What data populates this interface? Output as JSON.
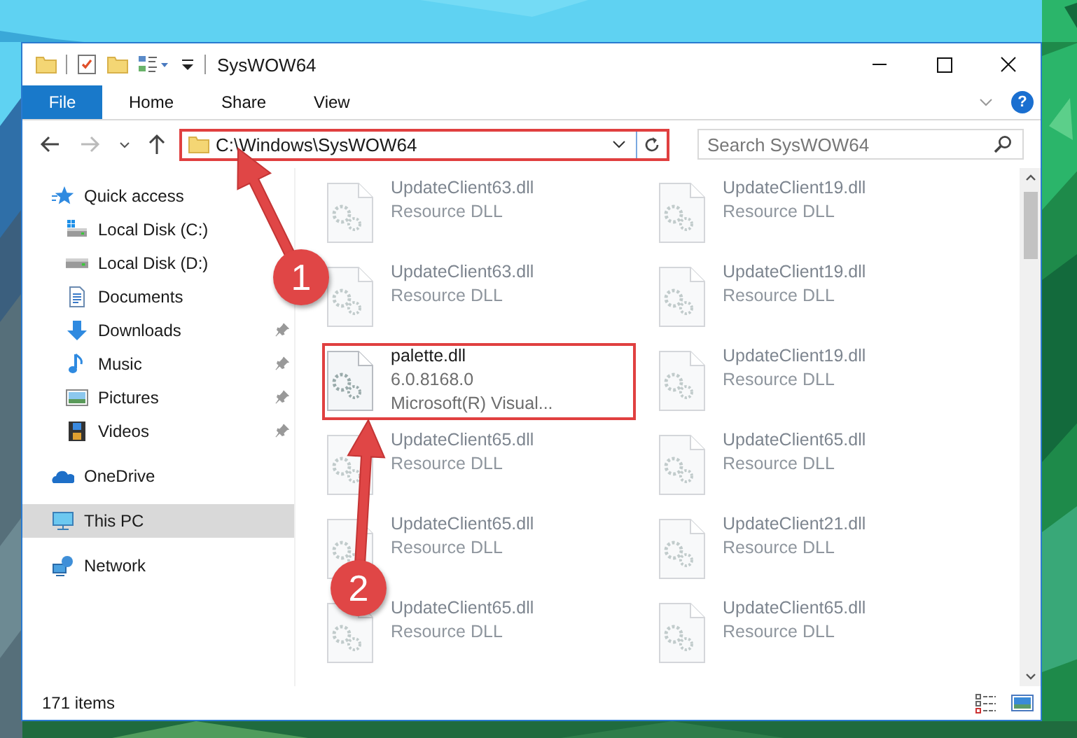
{
  "window": {
    "title": "SysWOW64"
  },
  "ribbon_tabs": [
    {
      "label": "File",
      "kind": "file",
      "selected": false
    },
    {
      "label": "Home",
      "kind": "tab",
      "selected": false
    },
    {
      "label": "Share",
      "kind": "tab",
      "selected": false
    },
    {
      "label": "View",
      "kind": "tab",
      "selected": false
    }
  ],
  "help_button": "?",
  "address": {
    "path": "C:\\Windows\\SysWOW64"
  },
  "search": {
    "placeholder": "Search SysWOW64"
  },
  "nav": [
    {
      "label": "Quick access",
      "kind": "star",
      "selected": false,
      "children": [
        {
          "label": "Local Disk (C:)",
          "kind": "windrive",
          "selected": false
        },
        {
          "label": "Local Disk (D:)",
          "kind": "drive",
          "selected": false
        },
        {
          "label": "Documents",
          "kind": "documents",
          "selected": false
        },
        {
          "label": "Downloads",
          "kind": "downloads",
          "selected": false,
          "pinned": true
        },
        {
          "label": "Music",
          "kind": "music",
          "selected": false,
          "pinned": true
        },
        {
          "label": "Pictures",
          "kind": "pictures",
          "selected": false,
          "pinned": true
        },
        {
          "label": "Videos",
          "kind": "videos",
          "selected": false,
          "pinned": true
        }
      ]
    },
    {
      "label": "OneDrive",
      "kind": "cloud",
      "selected": false
    },
    {
      "label": "This PC",
      "kind": "computer",
      "selected": true
    },
    {
      "label": "Network",
      "kind": "network",
      "selected": false
    }
  ],
  "files": [
    {
      "name": "UpdateClient63.dll",
      "details": [
        "Resource DLL"
      ],
      "faded": true
    },
    {
      "name": "UpdateClient19.dll",
      "details": [
        "Resource DLL"
      ],
      "faded": true
    },
    {
      "name": "UpdateClient63.dll",
      "details": [
        "Resource DLL"
      ],
      "faded": true
    },
    {
      "name": "UpdateClient19.dll",
      "details": [
        "Resource DLL"
      ],
      "faded": true
    },
    {
      "name": "palette.dll",
      "details": [
        "6.0.8168.0",
        "Microsoft(R) Visual..."
      ],
      "faded": false,
      "highlighted": true
    },
    {
      "name": "UpdateClient19.dll",
      "details": [
        "Resource DLL"
      ],
      "faded": true
    },
    {
      "name": "UpdateClient65.dll",
      "details": [
        "Resource DLL"
      ],
      "faded": true
    },
    {
      "name": "UpdateClient65.dll",
      "details": [
        "Resource DLL"
      ],
      "faded": true
    },
    {
      "name": "UpdateClient65.dll",
      "details": [
        "Resource DLL"
      ],
      "faded": true
    },
    {
      "name": "UpdateClient21.dll",
      "details": [
        "Resource DLL"
      ],
      "faded": true
    },
    {
      "name": "UpdateClient65.dll",
      "details": [
        "Resource DLL"
      ],
      "faded": true
    },
    {
      "name": "UpdateClient65.dll",
      "details": [
        "Resource DLL"
      ],
      "faded": true
    }
  ],
  "status_bar": {
    "item_count": "171 items"
  },
  "annotations": [
    {
      "number": "1"
    },
    {
      "number": "2"
    }
  ]
}
